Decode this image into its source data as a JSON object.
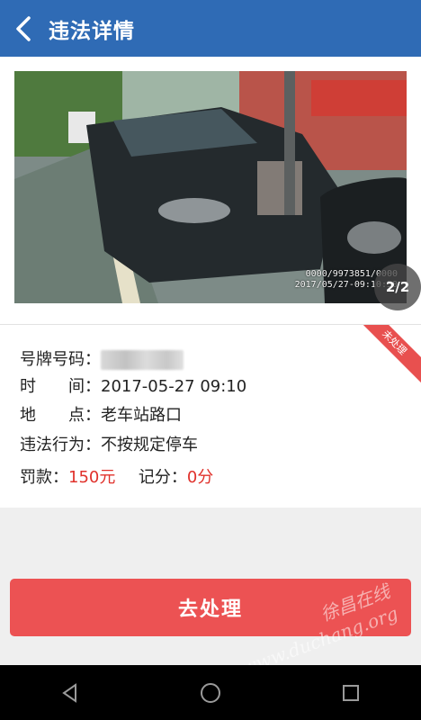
{
  "header": {
    "title": "违法详情"
  },
  "photo": {
    "stamp_line1": "0000/9973851/0000",
    "stamp_line2": "2017/05/27-09:10:50",
    "pager": "2/2"
  },
  "status_ribbon": "未处理",
  "details": {
    "plate_label": "号牌号码：",
    "time_label": "时　　间：",
    "time_value": "2017-05-27 09:10",
    "place_label": "地　　点：",
    "place_value": "老车站路口",
    "violation_label": "违法行为：",
    "violation_value": "不按规定停车",
    "fine_label": "罚款：",
    "fine_value": "150元",
    "points_label": "记分：",
    "points_value": "0分"
  },
  "action": {
    "label": "去处理"
  },
  "watermark": {
    "line1": "徐昌在线",
    "line2": "www.duchang.org"
  },
  "navbar": {
    "back_icon": "triangle-back-icon",
    "home_icon": "circle-home-icon",
    "recent_icon": "square-recent-icon"
  },
  "colors": {
    "header": "#2f6bb5",
    "action": "#ec5253",
    "emphasis": "#e0312b"
  }
}
